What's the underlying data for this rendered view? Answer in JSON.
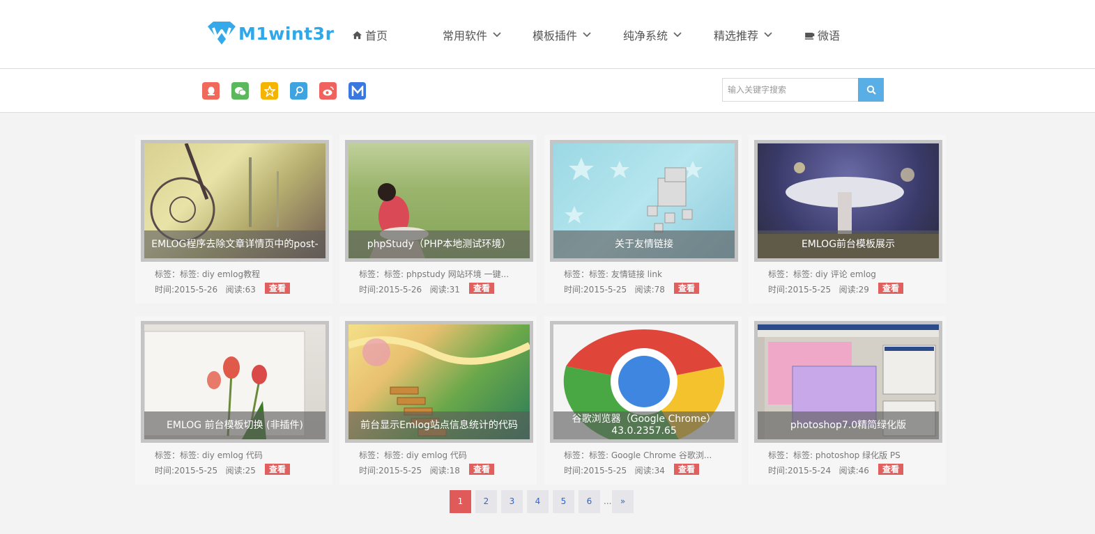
{
  "header": {
    "logo_text": "M1wint3r",
    "nav": [
      {
        "label": "首页",
        "icon": "home-icon"
      },
      {
        "label": "常用软件",
        "icon": "chevron-down-icon"
      },
      {
        "label": "模板插件",
        "icon": "chevron-down-icon"
      },
      {
        "label": "纯净系统",
        "icon": "chevron-down-icon"
      },
      {
        "label": "精选推荐",
        "icon": "chevron-down-icon"
      },
      {
        "label": "微语",
        "icon": "coffee-icon"
      }
    ]
  },
  "social": [
    {
      "icon": "qq-icon",
      "color": "#ef6a5a"
    },
    {
      "icon": "wechat-icon",
      "color": "#5cb85c"
    },
    {
      "icon": "qzone-icon",
      "color": "#f4b400"
    },
    {
      "icon": "tencent-weibo-icon",
      "color": "#3fa3e0"
    },
    {
      "icon": "weibo-icon",
      "color": "#f0625d"
    },
    {
      "icon": "m-logo-icon",
      "color": "#3a78e0"
    }
  ],
  "search": {
    "placeholder": "输入关键字搜索"
  },
  "posts": [
    {
      "title": "EMLOG程序去除文章详情页中的post-",
      "tags": "标签：标签: diy   emlog教程",
      "date": "时间:2015-5-26",
      "reads": "阅读:63",
      "button": "查看"
    },
    {
      "title": "phpStudy（PHP本地测试环境）",
      "tags": "标签：标签: phpstudy   网站环境   一键...",
      "date": "时间:2015-5-26",
      "reads": "阅读:31",
      "button": "查看"
    },
    {
      "title": "关于友情链接",
      "tags": "标签：标签: 友情链接   link",
      "date": "时间:2015-5-25",
      "reads": "阅读:78",
      "button": "查看"
    },
    {
      "title": "EMLOG前台模板展示",
      "tags": "标签：标签: diy   评论   emlog",
      "date": "时间:2015-5-25",
      "reads": "阅读:29",
      "button": "查看"
    },
    {
      "title": "EMLOG 前台模板切换 (非插件)",
      "tags": "标签：标签: diy   emlog   代码",
      "date": "时间:2015-5-25",
      "reads": "阅读:25",
      "button": "查看"
    },
    {
      "title": "前台显示Emlog站点信息统计的代码",
      "tags": "标签：标签: diy   emlog   代码",
      "date": "时间:2015-5-25",
      "reads": "阅读:18",
      "button": "查看"
    },
    {
      "title": "谷歌浏览器（Google Chrome）\n43.0.2357.65",
      "tags": "标签：标签: Google   Chrome   谷歌浏...",
      "date": "时间:2015-5-25",
      "reads": "阅读:34",
      "button": "查看"
    },
    {
      "title": "photoshop7.0精简绿化版",
      "tags": "标签：标签: photoshop   绿化版   PS",
      "date": "时间:2015-5-24",
      "reads": "阅读:46",
      "button": "查看"
    }
  ],
  "pagination": {
    "pages": [
      "1",
      "2",
      "3",
      "4",
      "5",
      "6"
    ],
    "current": "1",
    "ellipsis": "...",
    "next": "»",
    "active_color": "#e05a5a"
  }
}
